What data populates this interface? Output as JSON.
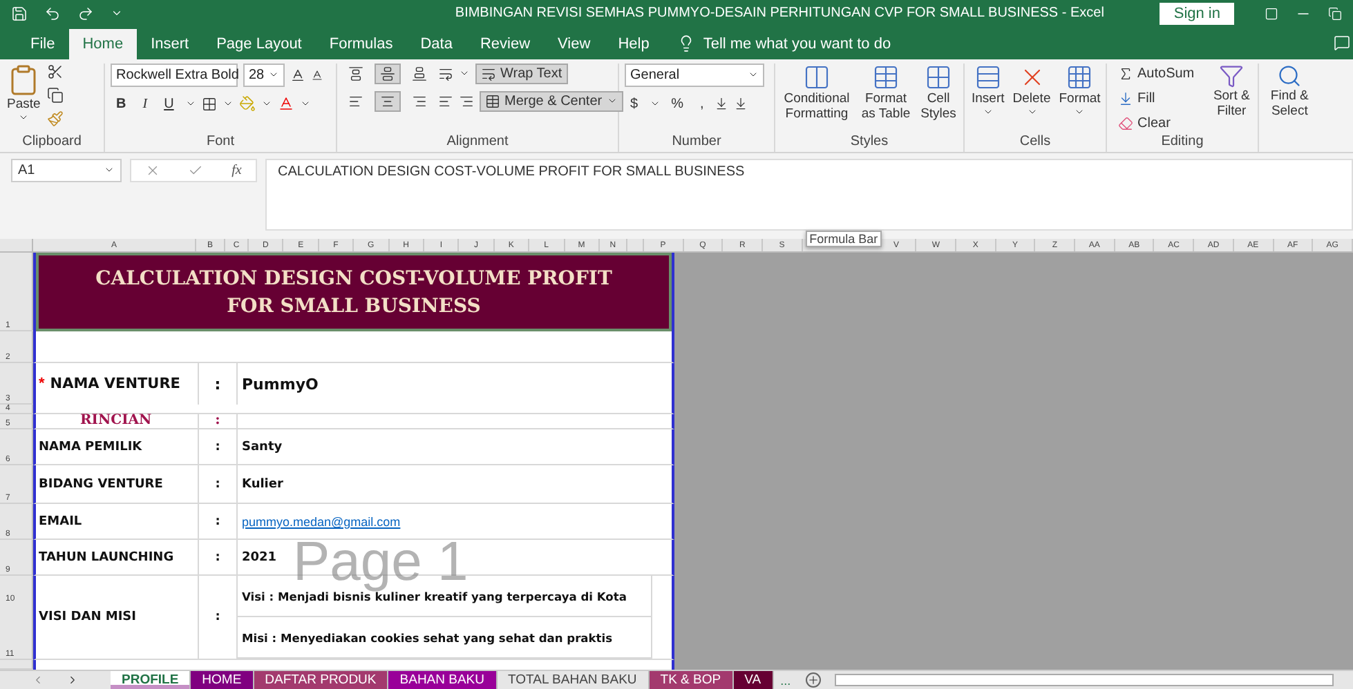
{
  "window": {
    "title": "BIMBINGAN REVISI SEMHAS PUMMYO-DESAIN PERHITUNGAN CVP FOR SMALL BUSINESS  -  Excel",
    "sign_in": "Sign in"
  },
  "ribbon_tabs": [
    {
      "label": "File",
      "selected": false
    },
    {
      "label": "Home",
      "selected": true
    },
    {
      "label": "Insert",
      "selected": false
    },
    {
      "label": "Page Layout",
      "selected": false
    },
    {
      "label": "Formulas",
      "selected": false
    },
    {
      "label": "Data",
      "selected": false
    },
    {
      "label": "Review",
      "selected": false
    },
    {
      "label": "View",
      "selected": false
    },
    {
      "label": "Help",
      "selected": false
    }
  ],
  "tell_me": "Tell me what you want to do",
  "clipboard": {
    "label": "Clipboard",
    "paste": "Paste"
  },
  "font": {
    "label": "Font",
    "name": "Rockwell Extra Bold",
    "size": "28",
    "bold": "B",
    "italic": "I",
    "underline": "U"
  },
  "alignment": {
    "label": "Alignment",
    "wrap_text": {
      "label": "Wrap Text",
      "on": true
    },
    "merge_center": {
      "label": "Merge & Center",
      "on": true
    },
    "align_buttons": [
      {
        "kind": "top",
        "on": false
      },
      {
        "kind": "middle",
        "on": true
      },
      {
        "kind": "bottom",
        "on": false
      },
      {
        "kind": "left",
        "on": false
      },
      {
        "kind": "center",
        "on": true
      },
      {
        "kind": "right",
        "on": false
      }
    ]
  },
  "number": {
    "label": "Number",
    "format": "General",
    "currency": "$",
    "percent": "%",
    "comma": ","
  },
  "styles": {
    "label": "Styles",
    "buttons": [
      {
        "kind": "conditional",
        "label": "Conditional Formatting"
      },
      {
        "kind": "table",
        "label": "Format as Table"
      },
      {
        "kind": "cell",
        "label": "Cell Styles"
      }
    ]
  },
  "cells": {
    "label": "Cells",
    "buttons": [
      {
        "kind": "insert",
        "label": "Insert"
      },
      {
        "kind": "delete",
        "label": "Delete"
      },
      {
        "kind": "format",
        "label": "Format"
      }
    ]
  },
  "editing": {
    "label": "Editing",
    "autosum": "AutoSum",
    "fill": "Fill",
    "clear": "Clear",
    "sort_filter": "Sort & Filter",
    "find_select": "Find & Select"
  },
  "formula_bar": {
    "name_box": "A1",
    "fx": "fx",
    "formula": "CALCULATION DESIGN COST-VOLUME PROFIT FOR SMALL BUSINESS",
    "tooltip": "Formula Bar"
  },
  "columns": [
    "A",
    "B",
    "C",
    "D",
    "E",
    "F",
    "G",
    "H",
    "I",
    "J",
    "K",
    "L",
    "M",
    "N"
  ],
  "right_columns_before": [
    "P",
    "Q",
    "R",
    "S"
  ],
  "right_columns_after": [
    "V",
    "W",
    "X",
    "Y",
    "Z",
    "AA",
    "AB",
    "AC",
    "AD",
    "AE",
    "AF",
    "AG"
  ],
  "rows": [
    {
      "kind": "title",
      "number": "1",
      "text": "CALCULATION DESIGN COST-VOLUME PROFIT FOR SMALL BUSINESS"
    },
    {
      "kind": "blank",
      "number": "2"
    },
    {
      "kind": "main",
      "number": "3",
      "marker": "*",
      "label": "NAMA VENTURE",
      "colon": ":",
      "value": "PummyO"
    },
    {
      "kind": "thin",
      "number": "4"
    },
    {
      "kind": "heading",
      "number": "5",
      "label": "RINCIAN",
      "colon": ":"
    },
    {
      "kind": "field",
      "number": "6",
      "label": "NAMA PEMILIK",
      "colon": ":",
      "value": "Santy"
    },
    {
      "kind": "field",
      "number": "7",
      "label": "BIDANG VENTURE",
      "colon": ":",
      "value": "Kulier"
    },
    {
      "kind": "link",
      "number": "8",
      "label": "EMAIL",
      "colon": ":",
      "value": "pummyo.medan@gmail.com"
    },
    {
      "kind": "field",
      "number": "9",
      "label": "TAHUN LAUNCHING",
      "colon": ":",
      "value": "2021"
    },
    {
      "kind": "multi",
      "numbers": [
        "10",
        "11"
      ],
      "label": "VISI DAN MISI",
      "colon": ":",
      "values": [
        "Visi : Menjadi bisnis kuliner kreatif yang terpercaya di Kota",
        "Misi : Menyediakan cookies sehat yang sehat dan praktis"
      ]
    }
  ],
  "page_label": "Page 1",
  "sheet_tabs": [
    {
      "label": "PROFILE",
      "selected": true,
      "color": "#c58fc5"
    },
    {
      "label": "HOME",
      "selected": false,
      "color": "#800080"
    },
    {
      "label": "DAFTAR PRODUK",
      "selected": false,
      "color": "#a33a6e"
    },
    {
      "label": "BAHAN BAKU",
      "selected": false,
      "color": "#990099"
    },
    {
      "label": "TOTAL BAHAN BAKU",
      "selected": false
    },
    {
      "label": "TK & BOP",
      "selected": false,
      "color": "#a33a6e"
    },
    {
      "label": "VA",
      "selected": false,
      "color": "#660033"
    }
  ],
  "more_tabs": "..."
}
